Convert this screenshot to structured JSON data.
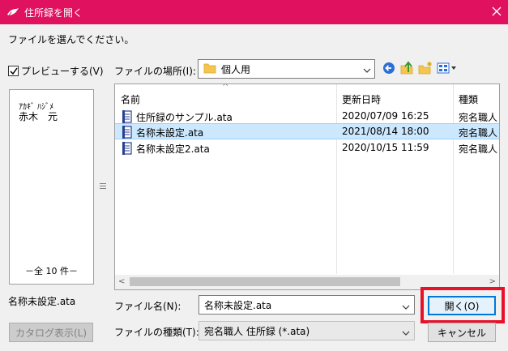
{
  "window": {
    "title": "住所録を開く",
    "title_bar_color": "#e0115f"
  },
  "instruction": "ファイルを選んでください。",
  "preview": {
    "checkbox_label": "プレビューする(V)",
    "checked": true,
    "kana": "ｱｶｷﾞ ﾊｼﾞﾒ",
    "name": "赤木　元",
    "count": "－全 10 件－"
  },
  "selected_file_label": "名称未設定.ata",
  "catalog_button": "カタログ表示(L)",
  "location": {
    "label": "ファイルの場所(I):",
    "value": "個人用"
  },
  "toolbar_icons": [
    "back-icon",
    "up-folder-icon",
    "new-folder-icon",
    "view-menu-icon"
  ],
  "filelist": {
    "columns": [
      "名前",
      "更新日時",
      "種類"
    ],
    "rows": [
      {
        "name": "住所録のサンプル.ata",
        "date": "2020/07/09 16:25",
        "type": "宛名職人",
        "selected": false
      },
      {
        "name": "名称未設定.ata",
        "date": "2021/08/14 18:00",
        "type": "宛名職人",
        "selected": true
      },
      {
        "name": "名称未設定2.ata",
        "date": "2020/10/15 11:59",
        "type": "宛名職人",
        "selected": false
      }
    ]
  },
  "filename": {
    "label": "ファイル名(N):",
    "value": "名称未設定.ata"
  },
  "filetype": {
    "label": "ファイルの種類(T):",
    "value": "宛名職人 住所録 (*.ata)"
  },
  "buttons": {
    "open": "開く(O)",
    "cancel": "キャンセル"
  },
  "colors": {
    "highlight": "#e8112a",
    "selection": "#cce8ff",
    "accent": "#0078d7"
  }
}
